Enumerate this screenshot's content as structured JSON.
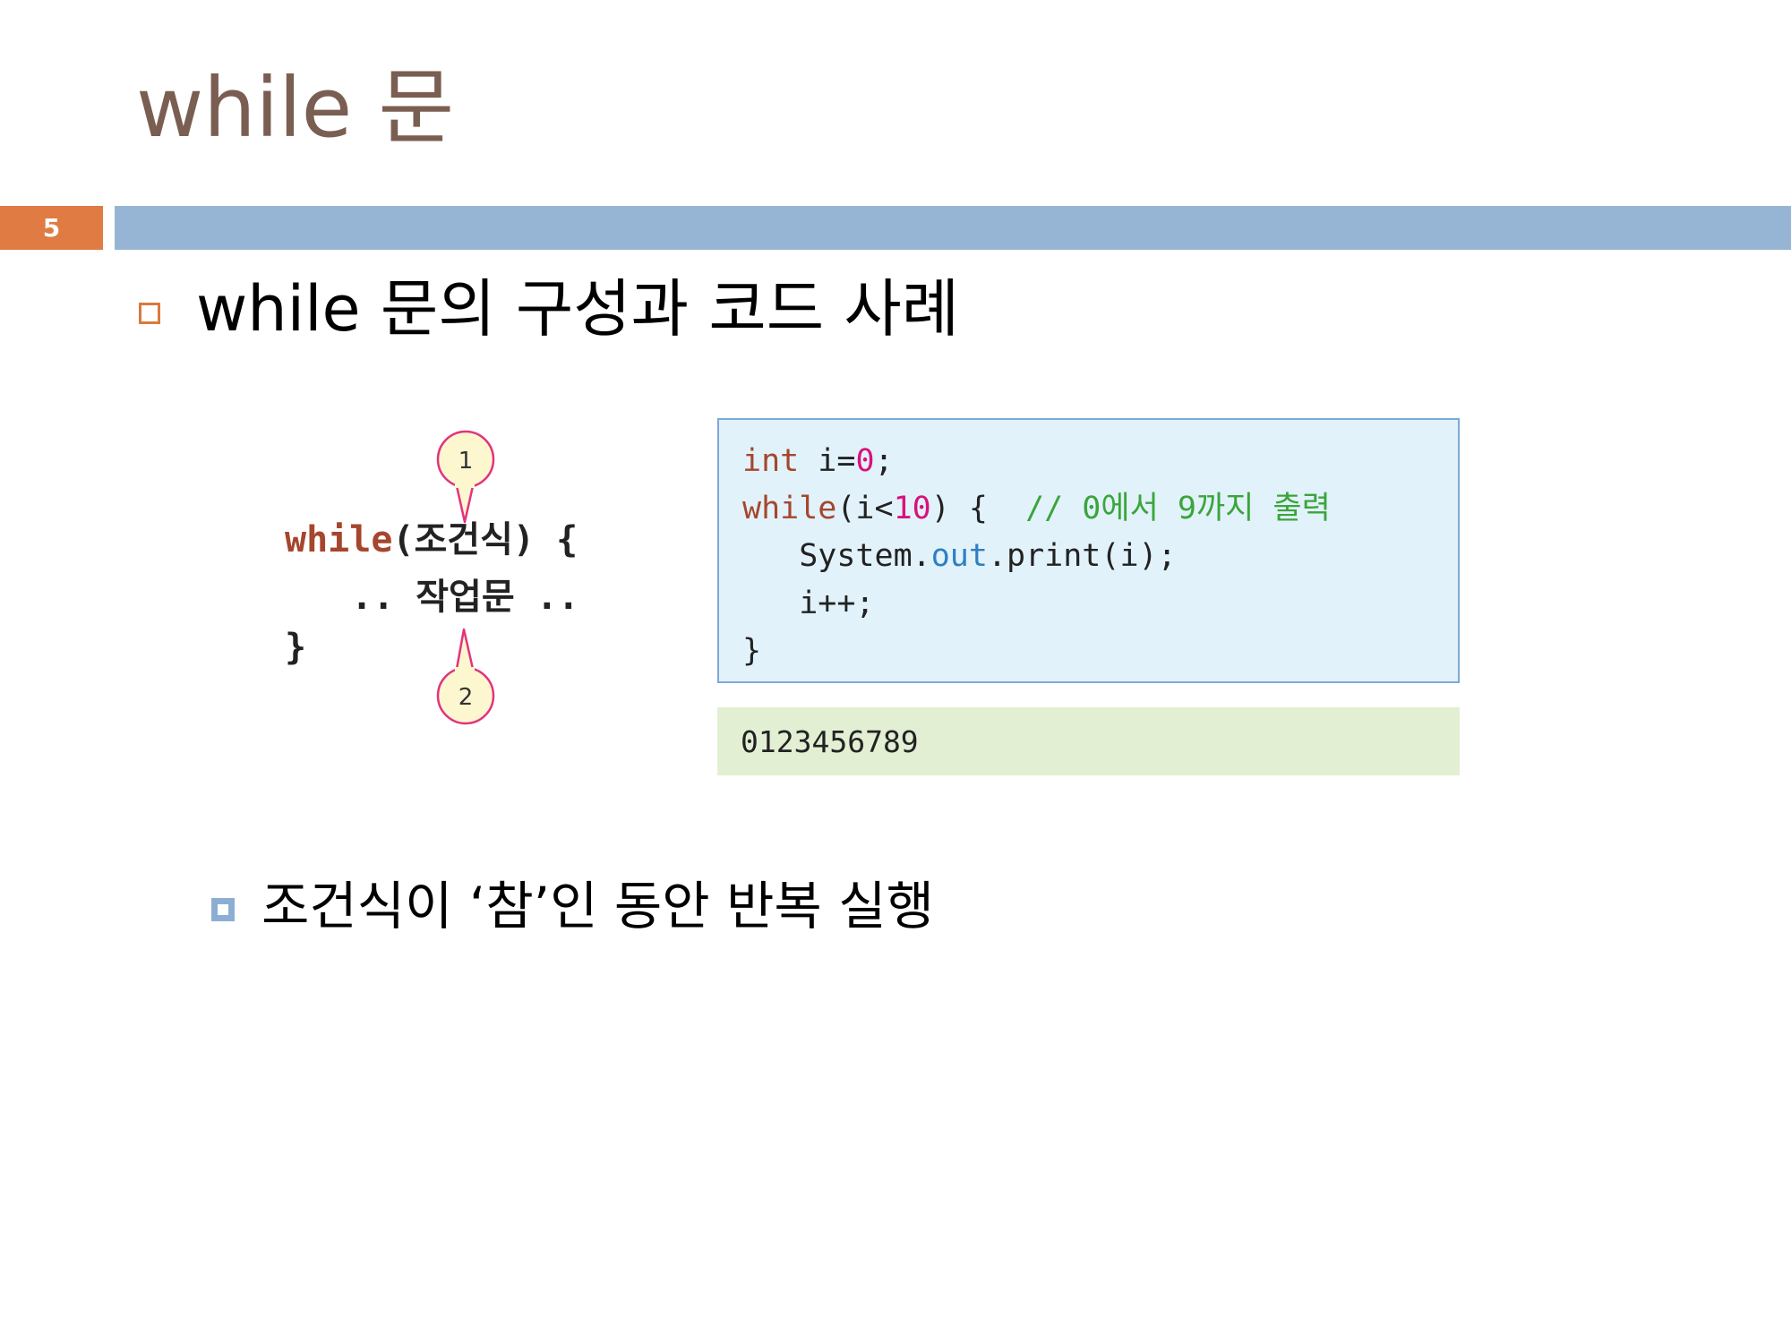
{
  "slide": {
    "title": "while 문",
    "page_number": "5"
  },
  "bullet1": {
    "text": "while 문의 구성과 코드 사례"
  },
  "diagram": {
    "line1_keyword": "while",
    "line1_rest": "(조건식) {",
    "line2": ".. 작업문 ..",
    "line3": "}",
    "marker1": "1",
    "marker2": "2"
  },
  "code": {
    "line1_kw": "int",
    "line1_a": " i=",
    "line1_num": "0",
    "line1_b": ";",
    "line2_kw": "while",
    "line2_a": "(i<",
    "line2_num": "10",
    "line2_b": ") {  ",
    "line2_comment": "// 0에서 9까지 출력",
    "line3_a": "   System.",
    "line3_field": "out",
    "line3_b": ".print(i);",
    "line4": "   i++;",
    "line5": "}"
  },
  "output": {
    "text": "0123456789"
  },
  "bullet2": {
    "text": "조건식이 ‘참’인 동안 반복 실행"
  },
  "colors": {
    "title": "#7a5e52",
    "page_box": "#e07b43",
    "header_bar": "#96b4d4",
    "code_bg": "#e2f2fb",
    "output_bg": "#e2efd3",
    "marker_fill": "#fdf7cf",
    "marker_stroke": "#e2337f"
  }
}
